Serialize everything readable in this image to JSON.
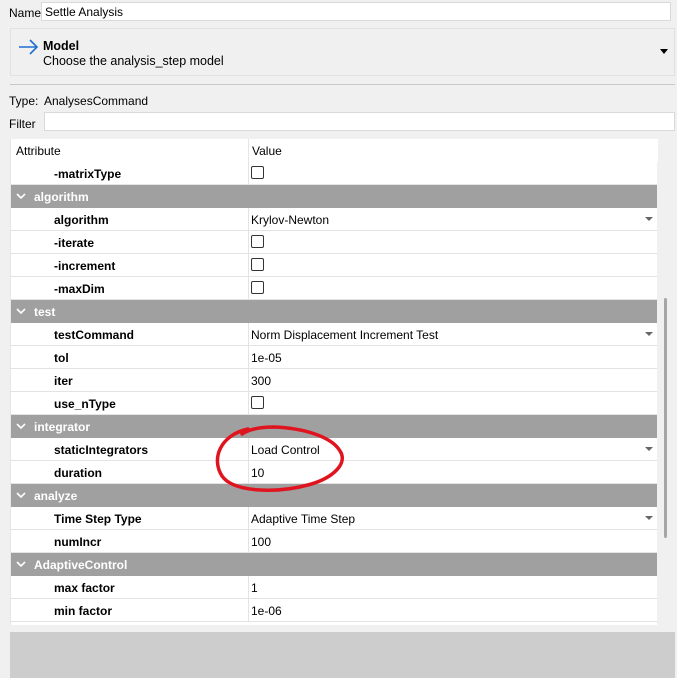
{
  "name_field": {
    "label": "Name",
    "value": "Settle Analysis"
  },
  "model": {
    "title": "Model",
    "subtitle": "Choose the analysis_step model",
    "icon": "arrow-right-icon"
  },
  "type": {
    "label": "Type:",
    "value": "AnalysesCommand"
  },
  "filter": {
    "label": "Filter",
    "value": ""
  },
  "table": {
    "headers": {
      "attribute": "Attribute",
      "value": "Value"
    },
    "rows": [
      {
        "kind": "attr",
        "name": "-matrixType",
        "control": "checkbox"
      },
      {
        "kind": "group",
        "name": "algorithm"
      },
      {
        "kind": "attr",
        "name": "algorithm",
        "value": "Krylov-Newton",
        "control": "dropdown"
      },
      {
        "kind": "attr",
        "name": "-iterate",
        "control": "checkbox"
      },
      {
        "kind": "attr",
        "name": "-increment",
        "control": "checkbox"
      },
      {
        "kind": "attr",
        "name": "-maxDim",
        "control": "checkbox"
      },
      {
        "kind": "group",
        "name": "test"
      },
      {
        "kind": "attr",
        "name": "testCommand",
        "value": "Norm Displacement Increment Test",
        "control": "dropdown"
      },
      {
        "kind": "attr",
        "name": "tol",
        "value": "1e-05",
        "control": "text"
      },
      {
        "kind": "attr",
        "name": "iter",
        "value": "300",
        "control": "text"
      },
      {
        "kind": "attr",
        "name": "use_nType",
        "control": "checkbox"
      },
      {
        "kind": "group",
        "name": "integrator"
      },
      {
        "kind": "attr",
        "name": "staticIntegrators",
        "value": "Load Control",
        "control": "dropdown"
      },
      {
        "kind": "attr",
        "name": "duration",
        "value": "10",
        "control": "text"
      },
      {
        "kind": "group",
        "name": "analyze"
      },
      {
        "kind": "attr",
        "name": "Time Step Type",
        "value": "Adaptive Time Step",
        "control": "dropdown"
      },
      {
        "kind": "attr",
        "name": "numIncr",
        "value": "100",
        "control": "text"
      },
      {
        "kind": "group",
        "name": "AdaptiveControl"
      },
      {
        "kind": "attr",
        "name": "max factor",
        "value": "1",
        "control": "text"
      },
      {
        "kind": "attr",
        "name": "min factor",
        "value": "1e-06",
        "control": "text"
      }
    ]
  },
  "colors": {
    "group_header": "#a0a0a0",
    "annotation": "#e0141e",
    "arrow": "#1e6fd0"
  }
}
